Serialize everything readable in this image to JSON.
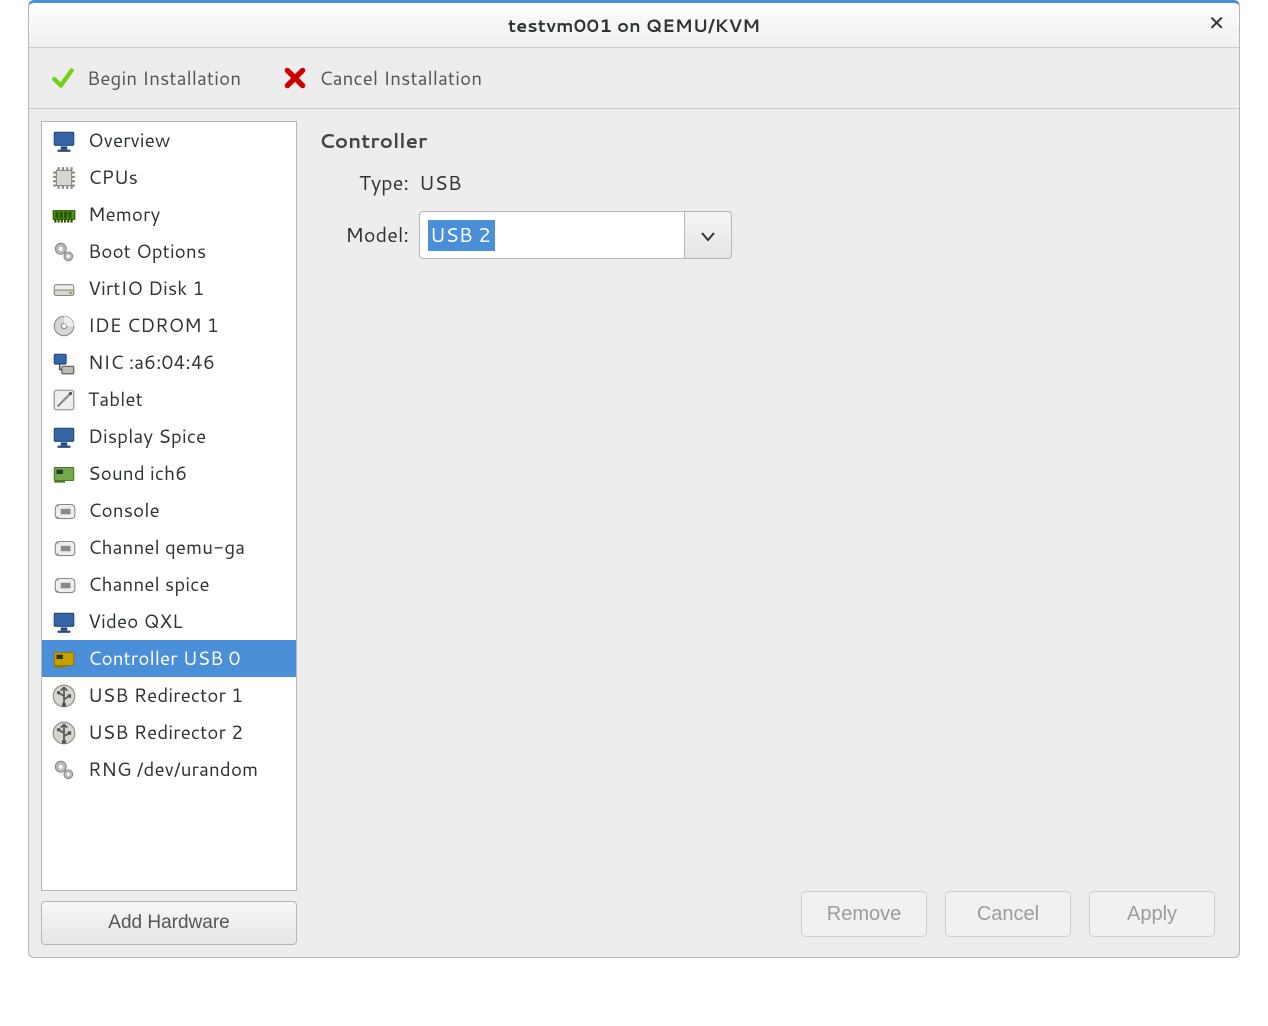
{
  "window": {
    "title": "testvm001 on QEMU/KVM"
  },
  "toolbar": {
    "begin_label": "Begin Installation",
    "cancel_label": "Cancel Installation"
  },
  "sidebar": {
    "items": [
      {
        "label": "Overview",
        "icon": "monitor-icon",
        "selected": false
      },
      {
        "label": "CPUs",
        "icon": "cpu-icon",
        "selected": false
      },
      {
        "label": "Memory",
        "icon": "memory-icon",
        "selected": false
      },
      {
        "label": "Boot Options",
        "icon": "gears-icon",
        "selected": false
      },
      {
        "label": "VirtIO Disk 1",
        "icon": "disk-icon",
        "selected": false
      },
      {
        "label": "IDE CDROM 1",
        "icon": "cdrom-icon",
        "selected": false
      },
      {
        "label": "NIC :a6:04:46",
        "icon": "nic-icon",
        "selected": false
      },
      {
        "label": "Tablet",
        "icon": "tablet-icon",
        "selected": false
      },
      {
        "label": "Display Spice",
        "icon": "display-icon",
        "selected": false
      },
      {
        "label": "Sound ich6",
        "icon": "sound-icon",
        "selected": false
      },
      {
        "label": "Console",
        "icon": "serial-icon",
        "selected": false
      },
      {
        "label": "Channel qemu-ga",
        "icon": "serial-icon",
        "selected": false
      },
      {
        "label": "Channel spice",
        "icon": "serial-icon",
        "selected": false
      },
      {
        "label": "Video QXL",
        "icon": "display-icon",
        "selected": false
      },
      {
        "label": "Controller USB 0",
        "icon": "controller-icon",
        "selected": true
      },
      {
        "label": "USB Redirector 1",
        "icon": "usb-icon",
        "selected": false
      },
      {
        "label": "USB Redirector 2",
        "icon": "usb-icon",
        "selected": false
      },
      {
        "label": "RNG /dev/urandom",
        "icon": "gears-icon",
        "selected": false
      }
    ],
    "add_hw_label": "Add Hardware"
  },
  "details": {
    "heading": "Controller",
    "type_label": "Type:",
    "type_value": "USB",
    "model_label": "Model:",
    "model_value": "USB 2"
  },
  "footer": {
    "remove_label": "Remove",
    "cancel_label": "Cancel",
    "apply_label": "Apply"
  },
  "icons": {
    "monitor-icon": {
      "fill": "#3465a4",
      "stroke": "#204a87",
      "shape": "monitor"
    },
    "cpu-icon": {
      "fill": "#d3d7cf",
      "stroke": "#888a85",
      "shape": "chip"
    },
    "memory-icon": {
      "fill": "#4e9a06",
      "stroke": "#2a5703",
      "shape": "ram"
    },
    "gears-icon": {
      "fill": "#babdb6",
      "stroke": "#888a85",
      "shape": "gears"
    },
    "disk-icon": {
      "fill": "#eeeeec",
      "stroke": "#888a85",
      "shape": "disk"
    },
    "cdrom-icon": {
      "fill": "#d3d7cf",
      "stroke": "#888a85",
      "shape": "cd"
    },
    "nic-icon": {
      "fill": "#babdb6",
      "stroke": "#555753",
      "shape": "nic"
    },
    "tablet-icon": {
      "fill": "#eeeeec",
      "stroke": "#888a85",
      "shape": "tablet"
    },
    "display-icon": {
      "fill": "#3465a4",
      "stroke": "#204a87",
      "shape": "monitor"
    },
    "sound-icon": {
      "fill": "#73a946",
      "stroke": "#4e7a2e",
      "shape": "card"
    },
    "serial-icon": {
      "fill": "#eeeeec",
      "stroke": "#888a85",
      "shape": "port"
    },
    "controller-icon": {
      "fill": "#c4a000",
      "stroke": "#8f7700",
      "shape": "card"
    },
    "usb-icon": {
      "fill": "#d3d7cf",
      "stroke": "#888a85",
      "shape": "usb"
    }
  }
}
